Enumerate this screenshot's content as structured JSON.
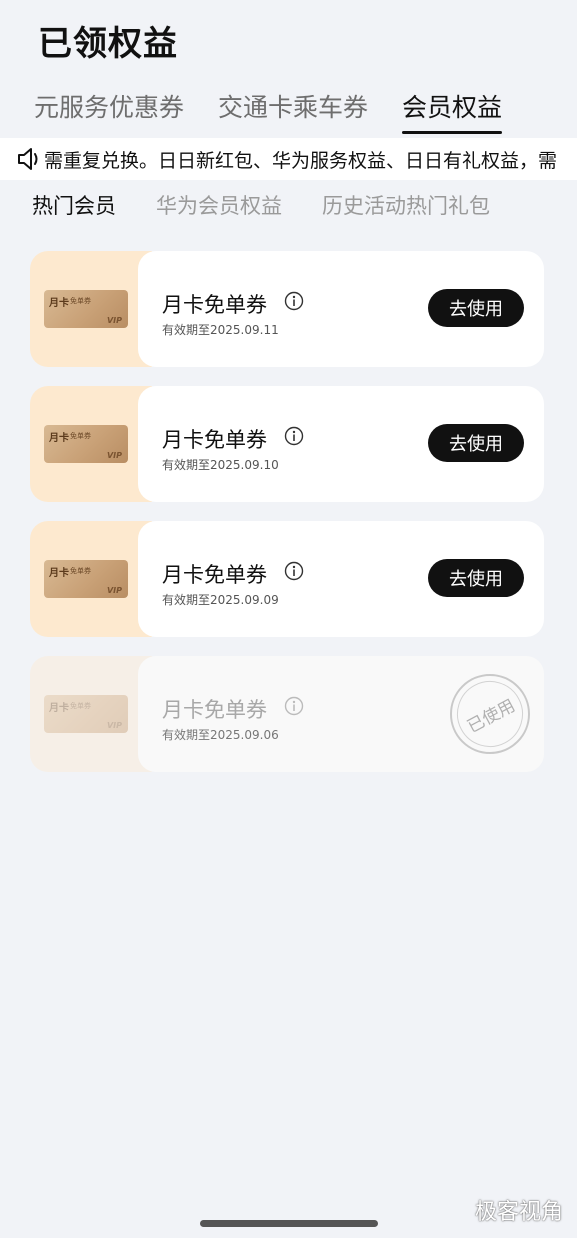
{
  "page_title": "已领权益",
  "top_tabs": [
    {
      "label": "元服务优惠券"
    },
    {
      "label": "交通卡乘车券"
    },
    {
      "label": "会员权益"
    }
  ],
  "notice": {
    "text": "需重复兑换。日日新红包、华为服务权益、日日有礼权益，需"
  },
  "sub_tabs": [
    {
      "label": "热门会员"
    },
    {
      "label": "华为会员权益"
    },
    {
      "label": "历史活动热门礼包"
    }
  ],
  "coupons": [
    {
      "name": "月卡免单券",
      "expiry": "有效期至2025.09.11",
      "action": "去使用",
      "thumb_label": "月卡",
      "thumb_sub": "免单券",
      "thumb_badge": "VIP"
    },
    {
      "name": "月卡免单券",
      "expiry": "有效期至2025.09.10",
      "action": "去使用",
      "thumb_label": "月卡",
      "thumb_sub": "免单券",
      "thumb_badge": "VIP"
    },
    {
      "name": "月卡免单券",
      "expiry": "有效期至2025.09.09",
      "action": "去使用",
      "thumb_label": "月卡",
      "thumb_sub": "免单券",
      "thumb_badge": "VIP"
    },
    {
      "name": "月卡免单券",
      "expiry": "有效期至2025.09.06",
      "status": "已使用",
      "thumb_label": "月卡",
      "thumb_sub": "免单券",
      "thumb_badge": "VIP"
    }
  ],
  "watermark": "极客视角",
  "colors": {
    "background": "#f1f3f7",
    "button": "#111111",
    "thumb_bg": "#fde9cf"
  }
}
